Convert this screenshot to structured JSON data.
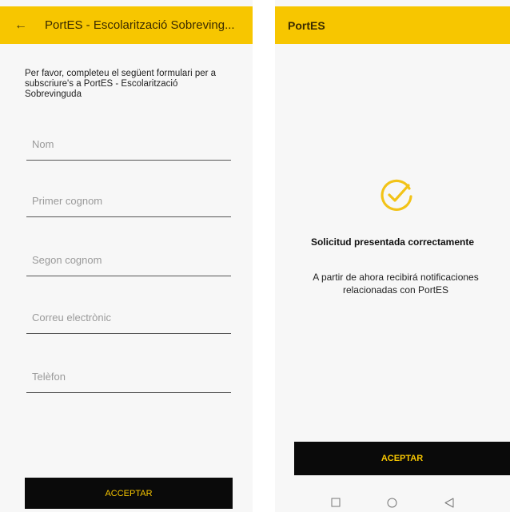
{
  "form_screen": {
    "title": "PortES - Escolarització Sobreving...",
    "intro": "Per favor, completeu el següent formulari per a subscriure's a PortES - Escolarització Sobrevinguda",
    "fields": [
      {
        "placeholder": "Nom"
      },
      {
        "placeholder": "Primer cognom"
      },
      {
        "placeholder": "Segon cognom"
      },
      {
        "placeholder": "Correu electrònic"
      },
      {
        "placeholder": "Telèfon"
      }
    ],
    "accept_label": "ACCEPTAR"
  },
  "success_screen": {
    "title": "PortES",
    "heading": "Solicitud presentada correctamente",
    "message": "A partir de ahora recibirá notificaciones relacionadas con PortES",
    "accept_label": "ACEPTAR"
  },
  "colors": {
    "accent": "#f7c600",
    "button_bg": "#0a0a0a",
    "background": "#f7f7f7"
  },
  "icons": [
    "back-arrow-icon",
    "check-circle-icon",
    "square-icon",
    "circle-icon",
    "triangle-back-icon"
  ]
}
